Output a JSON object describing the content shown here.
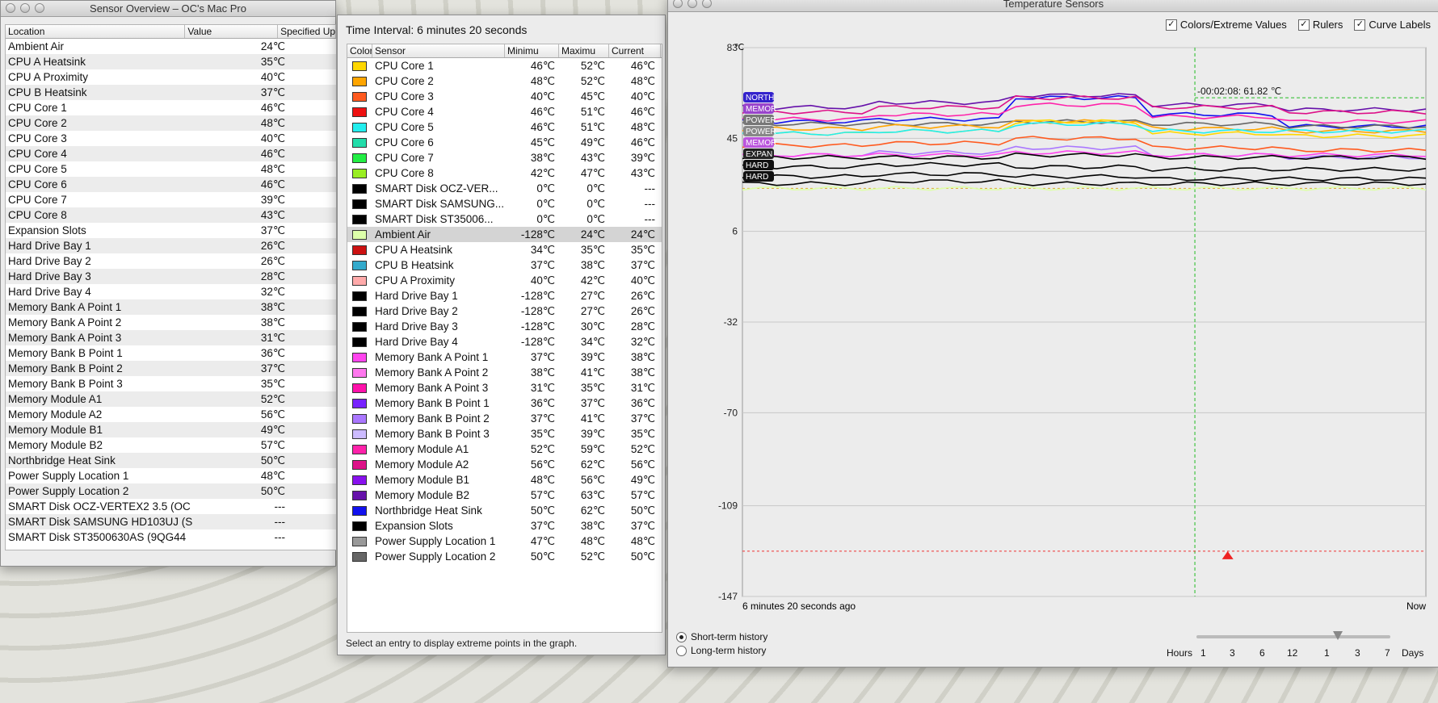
{
  "overview": {
    "title": "Sensor Overview – OC's Mac Pro",
    "headers": [
      "Location",
      "Value",
      "Specified Up"
    ],
    "rows": [
      [
        "Ambient Air",
        "24℃"
      ],
      [
        "CPU A Heatsink",
        "35℃"
      ],
      [
        "CPU A Proximity",
        "40℃"
      ],
      [
        "CPU B Heatsink",
        "37℃"
      ],
      [
        "CPU Core 1",
        "46℃"
      ],
      [
        "CPU Core 2",
        "48℃"
      ],
      [
        "CPU Core 3",
        "40℃"
      ],
      [
        "CPU Core 4",
        "46℃"
      ],
      [
        "CPU Core 5",
        "48℃"
      ],
      [
        "CPU Core 6",
        "46℃"
      ],
      [
        "CPU Core 7",
        "39℃"
      ],
      [
        "CPU Core 8",
        "43℃"
      ],
      [
        "Expansion Slots",
        "37℃"
      ],
      [
        "Hard Drive Bay 1",
        "26℃"
      ],
      [
        "Hard Drive Bay 2",
        "26℃"
      ],
      [
        "Hard Drive Bay 3",
        "28℃"
      ],
      [
        "Hard Drive Bay 4",
        "32℃"
      ],
      [
        "Memory Bank A Point 1",
        "38℃"
      ],
      [
        "Memory Bank A Point 2",
        "38℃"
      ],
      [
        "Memory Bank A Point 3",
        "31℃"
      ],
      [
        "Memory Bank B Point 1",
        "36℃"
      ],
      [
        "Memory Bank B Point 2",
        "37℃"
      ],
      [
        "Memory Bank B Point 3",
        "35℃"
      ],
      [
        "Memory Module A1",
        "52℃"
      ],
      [
        "Memory Module A2",
        "56℃"
      ],
      [
        "Memory Module B1",
        "49℃"
      ],
      [
        "Memory Module B2",
        "57℃"
      ],
      [
        "Northbridge Heat Sink",
        "50℃"
      ],
      [
        "Power Supply Location 1",
        "48℃"
      ],
      [
        "Power Supply Location 2",
        "50℃"
      ],
      [
        "SMART Disk OCZ-VERTEX2 3.5 (OC",
        "---"
      ],
      [
        "SMART Disk SAMSUNG HD103UJ (S",
        "---"
      ],
      [
        "SMART Disk ST3500630AS (9QG44",
        "---"
      ]
    ]
  },
  "sensors": {
    "interval": "Time Interval: 6 minutes 20 seconds",
    "headers": [
      "Color",
      "Sensor",
      "Minimu",
      "Maximu",
      "Current"
    ],
    "selected_index": 11,
    "rows": [
      {
        "color": "#ffd700",
        "name": "CPU Core 1",
        "min": "46℃",
        "max": "52℃",
        "cur": "46℃"
      },
      {
        "color": "#ffa500",
        "name": "CPU Core 2",
        "min": "48℃",
        "max": "52℃",
        "cur": "48℃"
      },
      {
        "color": "#ff5a1f",
        "name": "CPU Core 3",
        "min": "40℃",
        "max": "45℃",
        "cur": "40℃"
      },
      {
        "color": "#ee1111",
        "name": "CPU Core 4",
        "min": "46℃",
        "max": "51℃",
        "cur": "46℃"
      },
      {
        "color": "#22eeee",
        "name": "CPU Core 5",
        "min": "46℃",
        "max": "51℃",
        "cur": "48℃"
      },
      {
        "color": "#22ddaa",
        "name": "CPU Core 6",
        "min": "45℃",
        "max": "49℃",
        "cur": "46℃"
      },
      {
        "color": "#22ee44",
        "name": "CPU Core 7",
        "min": "38℃",
        "max": "43℃",
        "cur": "39℃"
      },
      {
        "color": "#99ee22",
        "name": "CPU Core 8",
        "min": "42℃",
        "max": "47℃",
        "cur": "43℃"
      },
      {
        "color": "#000000",
        "name": "SMART Disk OCZ-VER...",
        "min": "0℃",
        "max": "0℃",
        "cur": "---"
      },
      {
        "color": "#000000",
        "name": "SMART Disk SAMSUNG...",
        "min": "0℃",
        "max": "0℃",
        "cur": "---"
      },
      {
        "color": "#000000",
        "name": "SMART Disk ST35006...",
        "min": "0℃",
        "max": "0℃",
        "cur": "---"
      },
      {
        "color": "#ddffaa",
        "name": "Ambient Air",
        "min": "-128℃",
        "max": "24℃",
        "cur": "24℃"
      },
      {
        "color": "#cc1111",
        "name": "CPU A Heatsink",
        "min": "34℃",
        "max": "35℃",
        "cur": "35℃"
      },
      {
        "color": "#33aacc",
        "name": "CPU B Heatsink",
        "min": "37℃",
        "max": "38℃",
        "cur": "37℃"
      },
      {
        "color": "#ffaaaa",
        "name": "CPU A Proximity",
        "min": "40℃",
        "max": "42℃",
        "cur": "40℃"
      },
      {
        "color": "#000000",
        "name": "Hard Drive Bay 1",
        "min": "-128℃",
        "max": "27℃",
        "cur": "26℃"
      },
      {
        "color": "#000000",
        "name": "Hard Drive Bay 2",
        "min": "-128℃",
        "max": "27℃",
        "cur": "26℃"
      },
      {
        "color": "#000000",
        "name": "Hard Drive Bay 3",
        "min": "-128℃",
        "max": "30℃",
        "cur": "28℃"
      },
      {
        "color": "#000000",
        "name": "Hard Drive Bay 4",
        "min": "-128℃",
        "max": "34℃",
        "cur": "32℃"
      },
      {
        "color": "#ff44ee",
        "name": "Memory Bank A Point 1",
        "min": "37℃",
        "max": "39℃",
        "cur": "38℃"
      },
      {
        "color": "#ff77ee",
        "name": "Memory Bank A Point 2",
        "min": "38℃",
        "max": "41℃",
        "cur": "38℃"
      },
      {
        "color": "#ff11aa",
        "name": "Memory Bank A Point 3",
        "min": "31℃",
        "max": "35℃",
        "cur": "31℃"
      },
      {
        "color": "#7722ff",
        "name": "Memory Bank B Point 1",
        "min": "36℃",
        "max": "37℃",
        "cur": "36℃"
      },
      {
        "color": "#aa77ff",
        "name": "Memory Bank B Point 2",
        "min": "37℃",
        "max": "41℃",
        "cur": "37℃"
      },
      {
        "color": "#ccbbff",
        "name": "Memory Bank B Point 3",
        "min": "35℃",
        "max": "39℃",
        "cur": "35℃"
      },
      {
        "color": "#ff22aa",
        "name": "Memory Module A1",
        "min": "52℃",
        "max": "59℃",
        "cur": "52℃"
      },
      {
        "color": "#dd1188",
        "name": "Memory Module A2",
        "min": "56℃",
        "max": "62℃",
        "cur": "56℃"
      },
      {
        "color": "#8811ee",
        "name": "Memory Module B1",
        "min": "48℃",
        "max": "56℃",
        "cur": "49℃"
      },
      {
        "color": "#6611aa",
        "name": "Memory Module B2",
        "min": "57℃",
        "max": "63℃",
        "cur": "57℃"
      },
      {
        "color": "#1111ee",
        "name": "Northbridge Heat Sink",
        "min": "50℃",
        "max": "62℃",
        "cur": "50℃"
      },
      {
        "color": "#000000",
        "name": "Expansion Slots",
        "min": "37℃",
        "max": "38℃",
        "cur": "37℃"
      },
      {
        "color": "#999999",
        "name": "Power Supply Location 1",
        "min": "47℃",
        "max": "48℃",
        "cur": "48℃"
      },
      {
        "color": "#666666",
        "name": "Power Supply Location 2",
        "min": "50℃",
        "max": "52℃",
        "cur": "50℃"
      }
    ],
    "status": "Select an entry to display extreme points in the graph."
  },
  "graph": {
    "title": "Temperature Sensors",
    "checks": [
      "Colors/Extreme Values",
      "Rulers",
      "Curve Labels"
    ],
    "unit": "℃",
    "cursor_label": "-00:02:08: 61.82 ℃",
    "time_start": "6 minutes 20 seconds ago",
    "time_end": "Now",
    "history": [
      "Short-term history",
      "Long-term history"
    ],
    "scale_label_left": "Hours",
    "scale_label_right": "Days",
    "scale_ticks": [
      "1",
      "3",
      "6",
      "12",
      "1",
      "3",
      "7"
    ],
    "curve_labels": [
      "NORTH",
      "MEMOR",
      "POWER",
      "POWER",
      "MEMOR",
      "EXPAN",
      "HARD",
      "HARD"
    ]
  },
  "chart_data": {
    "type": "line",
    "ylabel": "℃",
    "ylim": [
      -147,
      83
    ],
    "yticks": [
      83,
      45,
      6,
      -32,
      -70,
      -109,
      -147
    ],
    "xlabel_start": "6 minutes 20 seconds ago",
    "xlabel_end": "Now",
    "series": [
      {
        "name": "Northbridge Heat Sink",
        "color": "#1111ee",
        "values": [
          52,
          53,
          62,
          55,
          50
        ]
      },
      {
        "name": "Memory Module B2",
        "color": "#6611aa",
        "values": [
          58,
          60,
          63,
          59,
          57
        ]
      },
      {
        "name": "Memory Module A2",
        "color": "#dd1188",
        "values": [
          56,
          58,
          62,
          58,
          56
        ]
      },
      {
        "name": "Memory Module A1",
        "color": "#ff22aa",
        "values": [
          53,
          55,
          59,
          54,
          52
        ]
      },
      {
        "name": "Power Supply Location 2",
        "color": "#666666",
        "values": [
          51,
          51,
          52,
          51,
          50
        ]
      },
      {
        "name": "CPU Core 2",
        "color": "#ffa500",
        "values": [
          49,
          50,
          52,
          49,
          48
        ]
      },
      {
        "name": "CPU Core 1",
        "color": "#ffd700",
        "values": [
          47,
          48,
          52,
          47,
          46
        ]
      },
      {
        "name": "CPU Core 5",
        "color": "#22eeee",
        "values": [
          47,
          48,
          51,
          48,
          48
        ]
      },
      {
        "name": "CPU Core 3",
        "color": "#ff5a1f",
        "values": [
          42,
          43,
          45,
          41,
          40
        ]
      },
      {
        "name": "Memory Bank B Point 2",
        "color": "#aa77ff",
        "values": [
          38,
          39,
          41,
          38,
          37
        ]
      },
      {
        "name": "Memory Bank A Point 1",
        "color": "#ff44ee",
        "values": [
          38,
          38,
          39,
          38,
          38
        ]
      },
      {
        "name": "Expansion Slots",
        "color": "#000000",
        "values": [
          37,
          37,
          38,
          37,
          37
        ]
      },
      {
        "name": "Hard Drive Bay 4",
        "color": "#000000",
        "values": [
          33,
          34,
          -128,
          32,
          32
        ]
      },
      {
        "name": "Hard Drive Bay 3",
        "color": "#000000",
        "values": [
          29,
          30,
          -128,
          28,
          28
        ]
      },
      {
        "name": "Hard Drive Bay 1",
        "color": "#000000",
        "values": [
          26,
          27,
          -128,
          26,
          26
        ]
      },
      {
        "name": "Ambient Air",
        "color": "#ddffaa",
        "values": [
          24,
          24,
          -128,
          24,
          24
        ]
      }
    ]
  }
}
